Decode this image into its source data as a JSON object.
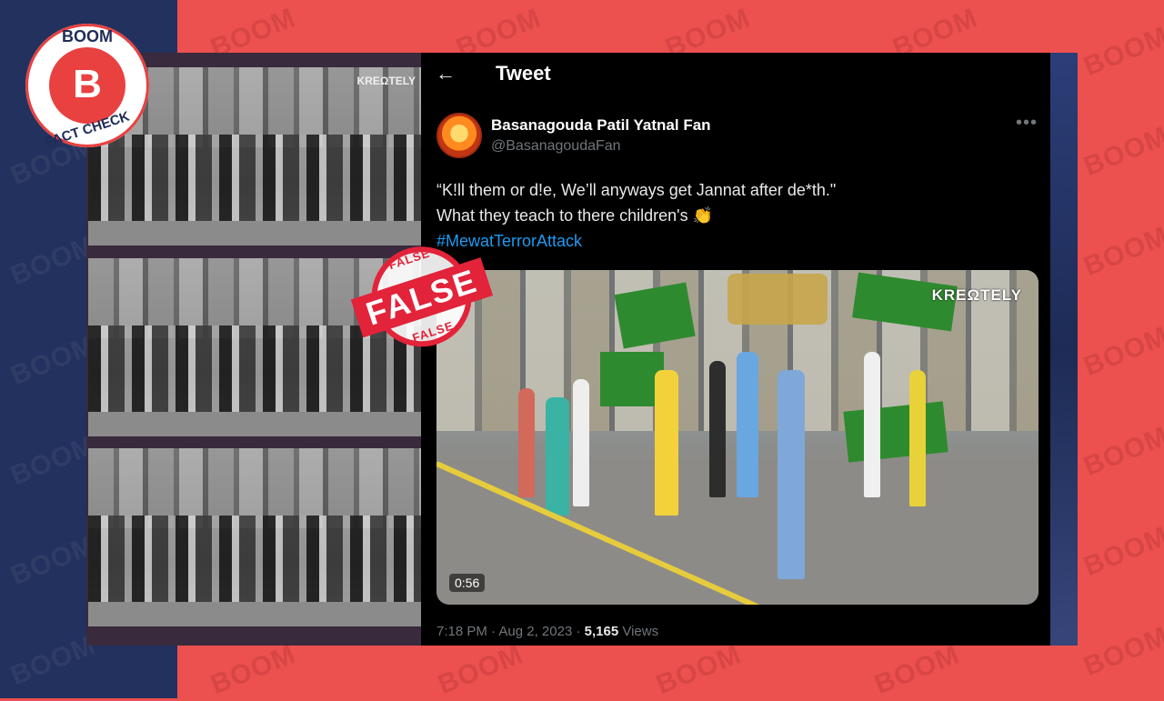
{
  "brand": {
    "watermark_text": "BOOM",
    "logo_top": "BOOM",
    "logo_letter": "B",
    "logo_bottom": "FACT CHECK",
    "stamp_label": "FALSE",
    "stamp_small": "FALSE"
  },
  "tweet": {
    "header_title": "Tweet",
    "author_name": "Basanagouda Patil Yatnal Fan",
    "author_handle": "@BasanagoudaFan",
    "text_line1": "“K!ll them or d!e, We’ll anyways get Jannat after de*th.\"",
    "text_line2": "What they teach to there children's",
    "emoji": "👏",
    "hashtag": "#MewatTerrorAttack",
    "video_watermark": "KREΩTELY",
    "video_duration": "0:56",
    "time": "7:18 PM",
    "date": "Aug 2, 2023",
    "views_count": "5,165",
    "views_label": "Views"
  },
  "stills": {
    "watermark": "KREΩTELY"
  },
  "colors": {
    "background_red": "#ec514f",
    "left_navy": "#22315d",
    "tweet_bg": "#000000",
    "hashtag_blue": "#1d9bf0",
    "stamp_red": "#e2233a"
  }
}
